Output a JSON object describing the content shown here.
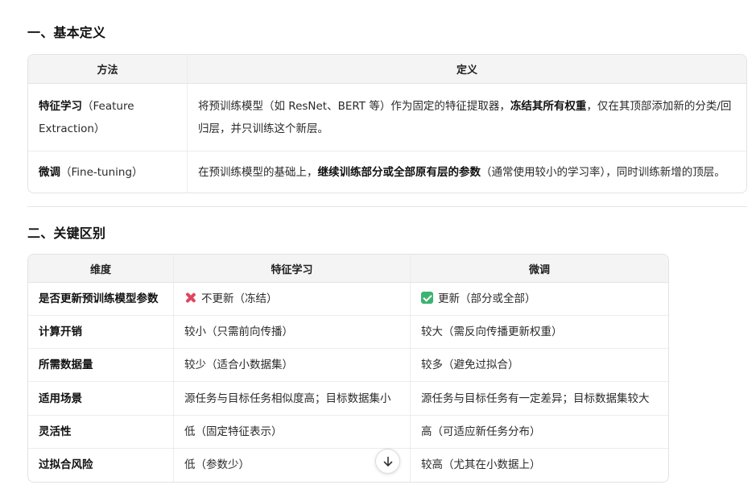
{
  "section1": {
    "heading": "一、基本定义",
    "headers": [
      "方法",
      "定义"
    ],
    "rows": [
      {
        "method_bold": "特征学习",
        "method_rest": "（Feature Extraction）",
        "def_pre": "将预训练模型（如 ResNet、BERT 等）作为固定的特征提取器，",
        "def_bold": "冻结其所有权重",
        "def_post": "，仅在其顶部添加新的分类/回归层，并只训练这个新层。"
      },
      {
        "method_bold": "微调",
        "method_rest": "（Fine-tuning）",
        "def_pre": "在预训练模型的基础上，",
        "def_bold": "继续训练部分或全部原有层的参数",
        "def_post": "（通常使用较小的学习率），同时训练新增的顶层。"
      }
    ]
  },
  "section2": {
    "heading": "二、关键区别",
    "headers": [
      "维度",
      "特征学习",
      "微调"
    ],
    "rows": [
      {
        "dim": "是否更新预训练模型参数",
        "fe": "不更新（冻结）",
        "ft": "更新（部分或全部）",
        "fe_icon": "cross-mark-icon",
        "ft_icon": "check-mark-icon"
      },
      {
        "dim": "计算开销",
        "fe": "较小（只需前向传播）",
        "ft": "较大（需反向传播更新权重）"
      },
      {
        "dim": "所需数据量",
        "fe": "较少（适合小数据集）",
        "ft": "较多（避免过拟合）"
      },
      {
        "dim": "适用场景",
        "fe": "源任务与目标任务相似度高；目标数据集小",
        "ft": "源任务与目标任务有一定差异；目标数据集较大"
      },
      {
        "dim": "灵活性",
        "fe": "低（固定特征表示）",
        "ft": "高（可适应新任务分布）"
      },
      {
        "dim": "过拟合风险",
        "fe": "低（参数少）",
        "ft": "较高（尤其在小数据上）"
      }
    ]
  },
  "scroll_button_icon": "arrow-down-icon"
}
